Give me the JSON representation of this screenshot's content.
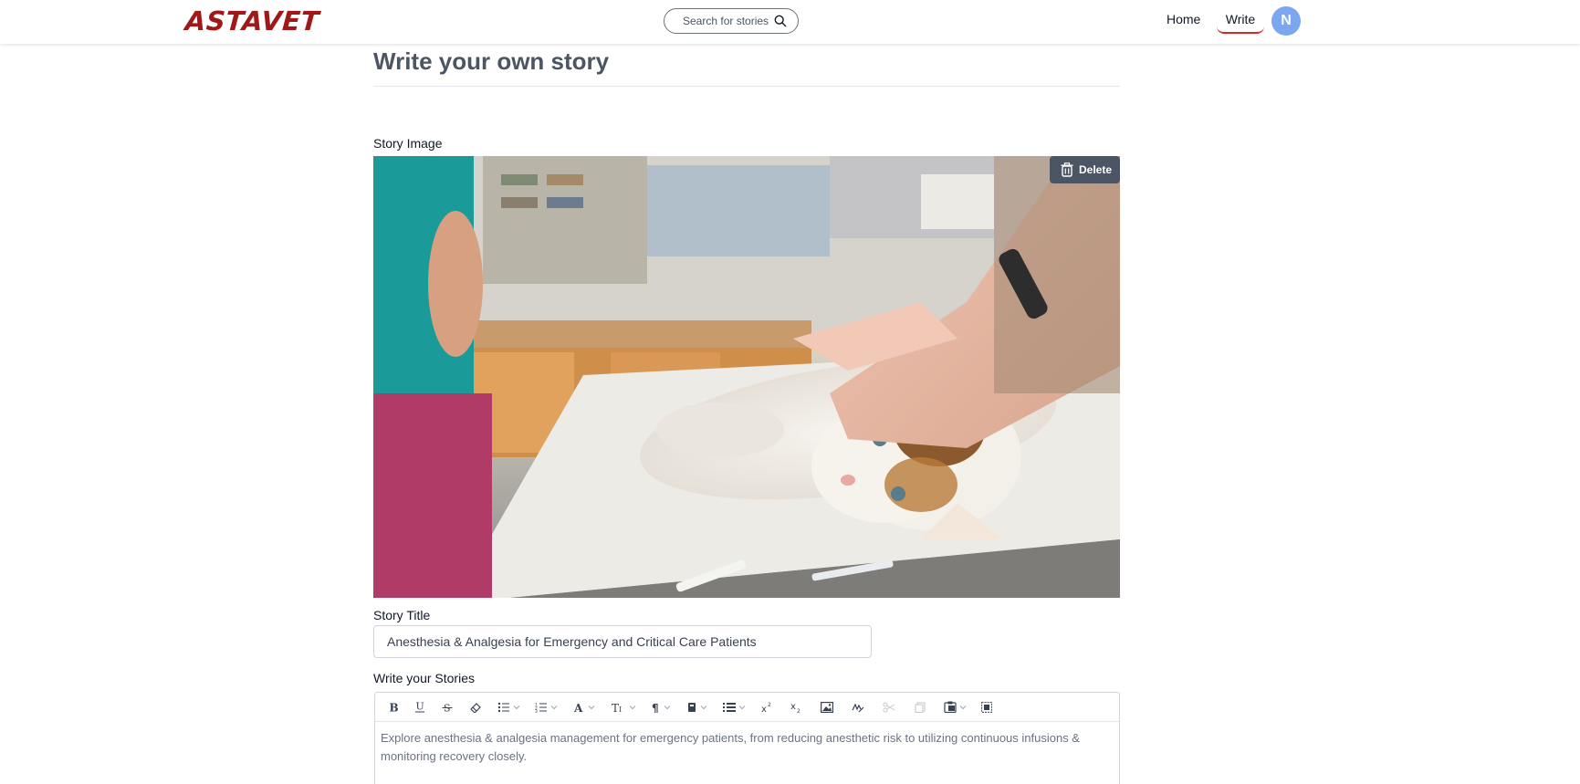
{
  "header": {
    "logo": "ASTAVET",
    "search_placeholder": "Search for stories",
    "nav": {
      "home": "Home",
      "write": "Write"
    },
    "avatar_initial": "N"
  },
  "page": {
    "title": "Write your own story",
    "story_image_label": "Story Image",
    "delete_label": "Delete",
    "story_title_label": "Story Title",
    "story_title_value": "Anesthesia & Analgesia for Emergency and Critical Care Patients",
    "editor_label": "Write your Stories",
    "editor_content": "Explore anesthesia & analgesia management for emergency patients, from reducing anesthetic risk to utilizing continuous infusions & monitoring recovery closely."
  },
  "toolbar_icons": [
    "bold-icon",
    "underline-icon",
    "strikethrough-icon",
    "eraser-icon",
    "bullet-list-icon",
    "numbered-list-icon",
    "font-color-icon",
    "font-size-icon",
    "paragraph-icon",
    "highlight-icon",
    "align-icon",
    "superscript-icon",
    "subscript-icon",
    "image-icon",
    "signature-icon",
    "cut-icon",
    "copy-icon",
    "paste-icon",
    "select-all-icon"
  ],
  "colors": {
    "brand": "#a01919",
    "accent_underline": "#dc2626",
    "avatar": "#7aa7f0",
    "delete_bg": "#4b5563"
  }
}
